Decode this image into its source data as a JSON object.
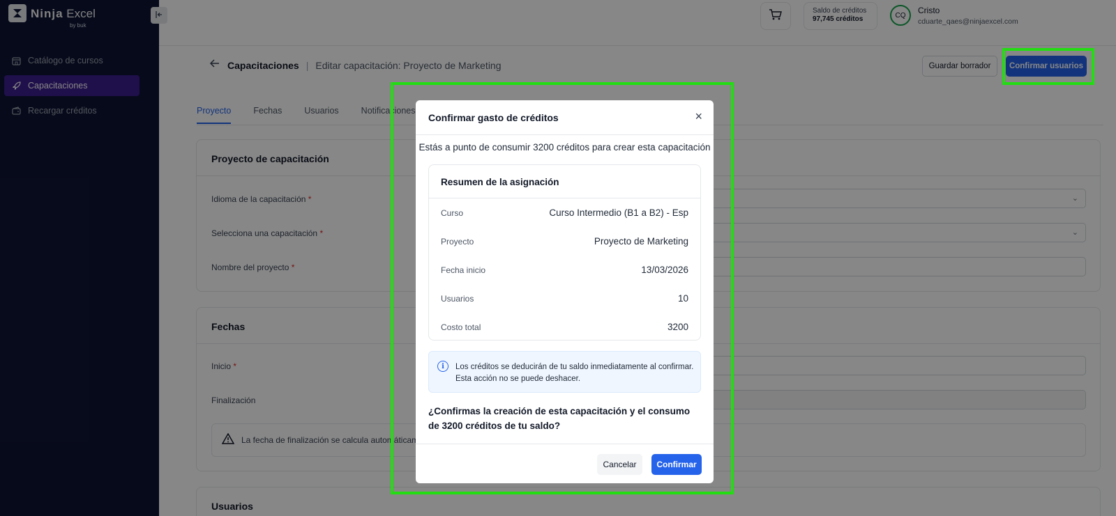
{
  "brand": {
    "name_bold": "Ninja",
    "name_light": "Excel",
    "byline": "by buk"
  },
  "sidebar": {
    "items": [
      {
        "label": "Catálogo de cursos",
        "icon": "store-icon",
        "active": false
      },
      {
        "label": "Capacitaciones",
        "icon": "rocket-icon",
        "active": true
      },
      {
        "label": "Recargar créditos",
        "icon": "wallet-icon",
        "active": false
      }
    ]
  },
  "header": {
    "credits_label": "Saldo de créditos",
    "credits_value": "97,745 créditos",
    "avatar_initials": "CQ",
    "user_name": "Cristo",
    "user_email": "cduarte_qaes@ninjaexcel.com"
  },
  "page": {
    "breadcrumb_main": "Capacitaciones",
    "breadcrumb_separator": "|",
    "breadcrumb_sub": "Editar capacitación: Proyecto de Marketing",
    "save_draft_label": "Guardar borrador",
    "confirm_users_label": "Confirmar usuarios",
    "tabs": [
      "Proyecto",
      "Fechas",
      "Usuarios",
      "Notificaciones"
    ],
    "project_card": {
      "title": "Proyecto de capacitación",
      "language_label": "Idioma de la capacitación",
      "select_label": "Selecciona una capacitación",
      "name_label": "Nombre del proyecto",
      "required_mark": "*"
    },
    "dates_card": {
      "title": "Fechas",
      "start_label": "Inicio",
      "end_label": "Finalización",
      "warning_text": "La fecha de finalización se calcula automáticamente"
    },
    "users_card": {
      "title": "Usuarios"
    }
  },
  "modal": {
    "title": "Confirmar gasto de créditos",
    "close_glyph": "×",
    "intro": "Estás a punto de consumir 3200 créditos para crear esta capacitación",
    "summary_title": "Resumen de la asignación",
    "rows": [
      {
        "key": "Curso",
        "value": "Curso Intermedio (B1 a B2) - Esp"
      },
      {
        "key": "Proyecto",
        "value": "Proyecto de Marketing"
      },
      {
        "key": "Fecha inicio",
        "value": "13/03/2026"
      },
      {
        "key": "Usuarios",
        "value": "10"
      },
      {
        "key": "Costo total",
        "value": "3200"
      }
    ],
    "info_text": "Los créditos se deducirán de tu saldo inmediatamente al confirmar. Esta acción no se puede deshacer.",
    "question": "¿Confirmas la creación de esta capacitación y el consumo de 3200 créditos de tu saldo?",
    "cancel_label": "Cancelar",
    "confirm_label": "Confirmar"
  },
  "colors": {
    "sidebar_bg": "#0f1433",
    "active_nav": "#3b1d8f",
    "primary": "#2563eb",
    "highlight": "#22dd11"
  }
}
